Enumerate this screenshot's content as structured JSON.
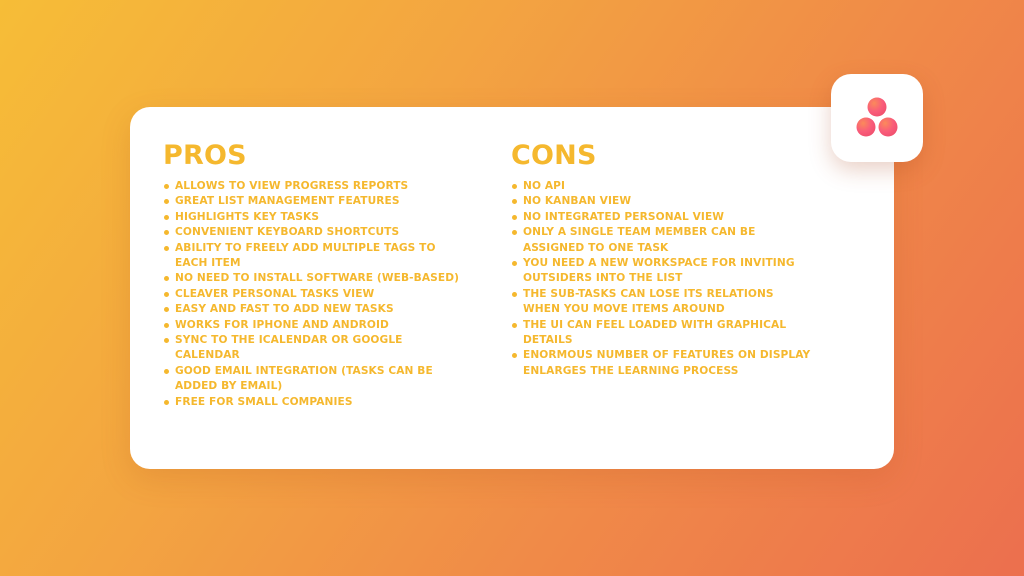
{
  "logo": {
    "icon": "asana-logo-icon",
    "colors": [
      "#f95c7a",
      "#fb8a5a"
    ]
  },
  "pros": {
    "title": "PROS",
    "items": [
      "ALLOWS TO VIEW PROGRESS REPORTS",
      "GREAT LIST MANAGEMENT FEATURES",
      "HIGHLIGHTS KEY TASKS",
      "CONVENIENT KEYBOARD SHORTCUTS",
      "ABILITY TO FREELY ADD MULTIPLE TAGS TO EACH ITEM",
      "NO NEED TO INSTALL SOFTWARE (WEB-BASED)",
      "CLEAVER PERSONAL TASKS VIEW",
      "EASY AND FAST TO ADD NEW TASKS",
      "WORKS FOR IPHONE AND ANDROID",
      "SYNC TO THE ICALENDAR OR GOOGLE CALENDAR",
      "GOOD EMAIL INTEGRATION (TASKS CAN BE ADDED BY EMAIL)",
      "FREE FOR SMALL COMPANIES"
    ]
  },
  "cons": {
    "title": "CONS",
    "items": [
      "NO API",
      "NO KANBAN VIEW",
      "NO INTEGRATED PERSONAL VIEW",
      "ONLY A SINGLE TEAM MEMBER CAN BE ASSIGNED TO ONE TASK",
      "YOU NEED A NEW WORKSPACE FOR INVITING OUTSIDERS INTO THE LIST",
      "THE SUB-TASKS CAN LOSE ITS RELATIONS WHEN YOU MOVE ITEMS AROUND",
      "THE UI CAN FEEL LOADED WITH GRAPHICAL DETAILS",
      "ENORMOUS NUMBER OF FEATURES ON DISPLAY ENLARGES THE LEARNING PROCESS"
    ]
  },
  "colors": {
    "accent": "#f5b82e",
    "background_start": "#f6bd37",
    "background_end": "#ec6f4e",
    "card": "#ffffff"
  }
}
